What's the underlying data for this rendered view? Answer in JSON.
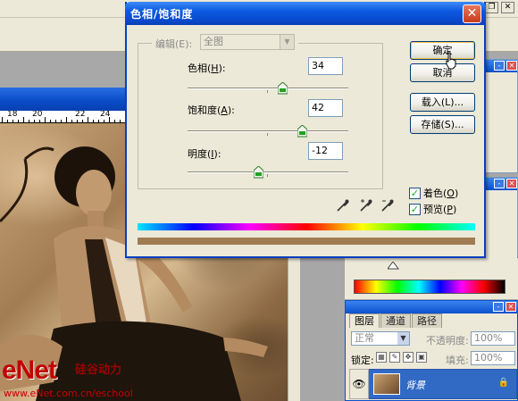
{
  "dialog": {
    "title": "色相/饱和度",
    "close_label": "✕",
    "edit": {
      "label": "编辑(E):",
      "value": "全图"
    },
    "hue": {
      "label": "色相(",
      "key": "H",
      "suffix": "):",
      "value": "34",
      "slider": 0.59
    },
    "saturation": {
      "label": "饱和度(",
      "key": "A",
      "suffix": "):",
      "value": "42",
      "slider": 0.71
    },
    "lightness": {
      "label": "明度(",
      "key": "I",
      "suffix": "):",
      "value": "-12",
      "slider": 0.44
    },
    "buttons": {
      "ok": "确定",
      "cancel": "取消",
      "load": "载入(L)...",
      "save": "存储(S)..."
    },
    "colorize": {
      "label": "着色(",
      "key": "O",
      "suffix": ")",
      "checked": true
    },
    "preview": {
      "label": "预览(",
      "key": "P",
      "suffix": ")",
      "checked": true
    }
  },
  "document": {
    "ruler_labels": [
      "18",
      "20",
      "22",
      "24"
    ]
  },
  "layers_panel": {
    "tabs": [
      "图层",
      "通道",
      "路径"
    ],
    "blend_mode": "正常",
    "opacity_label": "不透明度:",
    "opacity_value": "100%",
    "lock_label": "锁定:",
    "fill_label": "填充:",
    "fill_value": "100%",
    "layer_name": "背景"
  },
  "watermark": {
    "logo": "eNet",
    "cn": "硅谷动力",
    "url": "www.eNet.com.cn/eschool"
  },
  "colors": {
    "titlebar": "#0a4bd0",
    "dialog_bg": "#ece9d8",
    "colorize_bar": "#a07c52"
  }
}
